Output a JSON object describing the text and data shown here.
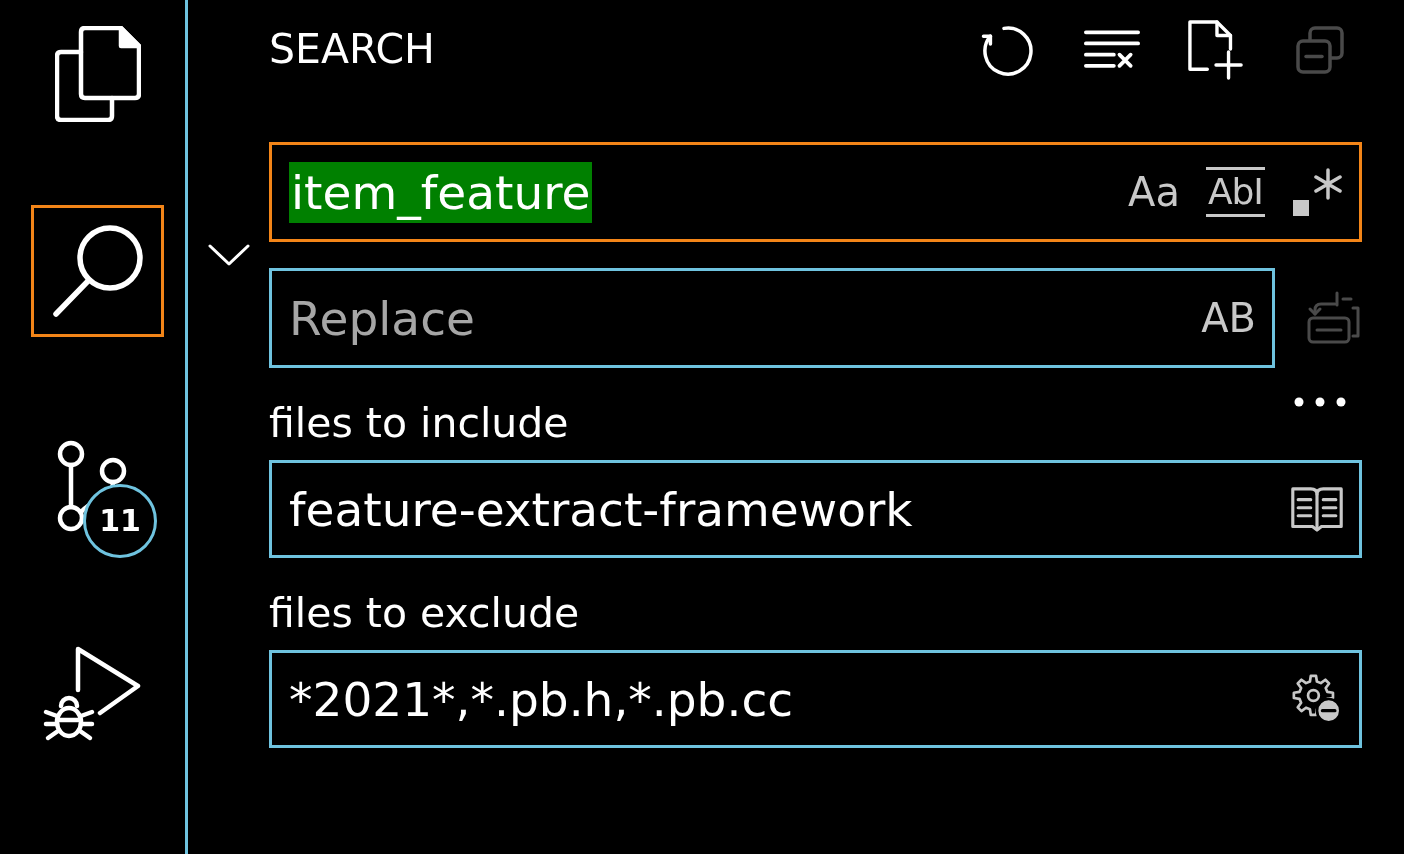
{
  "activity_bar": {
    "items": [
      {
        "kind": "files",
        "selected": false
      },
      {
        "kind": "search",
        "selected": true
      },
      {
        "kind": "source-control",
        "selected": false,
        "badge": "11"
      },
      {
        "kind": "debug",
        "selected": false
      }
    ]
  },
  "search_panel": {
    "title": "SEARCH",
    "actions": [
      {
        "kind": "refresh",
        "disabled": false
      },
      {
        "kind": "clear",
        "disabled": false
      },
      {
        "kind": "new-file",
        "disabled": false
      },
      {
        "kind": "collapse",
        "disabled": true
      }
    ],
    "replace_expanded": true,
    "search_field": {
      "value": "item_feature",
      "value_selected": true,
      "focused": true,
      "options": [
        {
          "kind": "match-case",
          "label": "Aa"
        },
        {
          "kind": "whole-word",
          "label": "AbI"
        },
        {
          "kind": "regex"
        }
      ]
    },
    "replace_field": {
      "placeholder": "Replace",
      "focused": false,
      "options": [
        {
          "kind": "preserve-case",
          "label": "AB"
        }
      ]
    },
    "replace_all": {
      "disabled": true
    },
    "include": {
      "label": "files to include",
      "value": "feature-extract-framework"
    },
    "exclude": {
      "label": "files to exclude",
      "value": "*2021*,*.pb.h,*.pb.cc"
    }
  }
}
